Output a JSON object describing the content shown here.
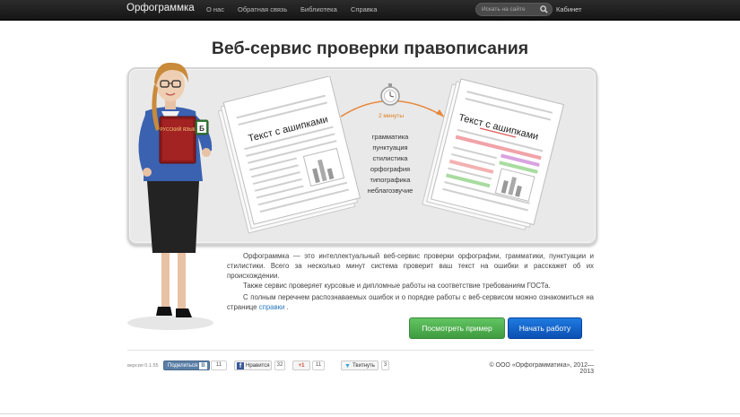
{
  "nav": {
    "brand": "Орфограммка",
    "links": [
      "О нас",
      "Обратная связь",
      "Библиотека",
      "Справка"
    ],
    "search_placeholder": "Искать на сайте",
    "cabinet": "Кабинет"
  },
  "hero": {
    "title": "Веб-сервис проверки правописания"
  },
  "illustration": {
    "doc_before_label": "Текст с ашипками",
    "doc_after_label": "Текст с ашипками",
    "timer_label": "2 минуты",
    "book_label": "РУССКИЙ ЯЗЫК",
    "badge_letter": "Б",
    "checks": [
      "грамматика",
      "пунктуация",
      "стилистика",
      "орфография",
      "типографика",
      "неблагозвучие"
    ]
  },
  "description": {
    "p1": "Орфограммка — это интеллектуальный веб-сервис проверки орфографии, грамматики, пунктуации и стилистики. Всего за несколько минут система проверит ваш текст на ошибки и расскажет об их происхождении.",
    "p2": "Также сервис проверяет курсовые и дипломные работы на соответствие требованиям ГОСТа.",
    "p3_before": "С полным перечнем распознаваемых ошибок и о порядке работы с веб-сервисом можно ознакомиться на странице",
    "p3_link": "справки",
    "p3_after": "."
  },
  "actions": {
    "example_button": "Посмотреть пример",
    "start_button": "Начать работу"
  },
  "footer": {
    "version": "версия 0.1.55",
    "vk_label": "Поделиться",
    "vk_count": "11",
    "fb_label": "Нравится",
    "fb_count": "32",
    "gplus_label": "+1",
    "gplus_count": "11",
    "tw_label": "Твитнуть",
    "tw_count": "3",
    "copyright": "© ООО «Орфограмматика», 2012—2013"
  },
  "colors": {
    "navbar": "#1f1f1f",
    "accent_orange": "#e17c1c",
    "green_button": "#4cae4c",
    "blue_button": "#1566cc",
    "link": "#2a7bc1"
  }
}
